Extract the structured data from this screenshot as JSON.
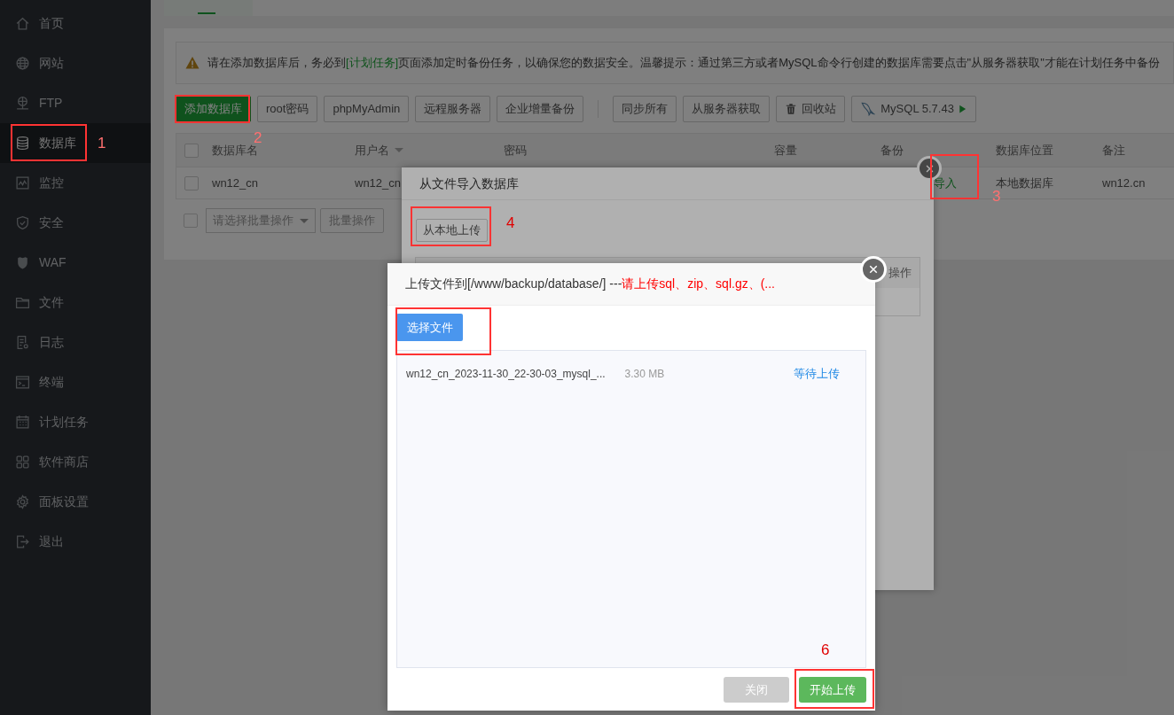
{
  "sidebar": {
    "items": [
      {
        "label": "首页",
        "selected": false
      },
      {
        "label": "网站",
        "selected": false
      },
      {
        "label": "FTP",
        "selected": false
      },
      {
        "label": "数据库",
        "selected": true
      },
      {
        "label": "监控",
        "selected": false
      },
      {
        "label": "安全",
        "selected": false
      },
      {
        "label": "WAF",
        "selected": false
      },
      {
        "label": "文件",
        "selected": false
      },
      {
        "label": "日志",
        "selected": false
      },
      {
        "label": "终端",
        "selected": false
      },
      {
        "label": "计划任务",
        "selected": false
      },
      {
        "label": "软件商店",
        "selected": false
      },
      {
        "label": "面板设置",
        "selected": false
      },
      {
        "label": "退出",
        "selected": false
      }
    ]
  },
  "alert": {
    "before": "请在添加数据库后，务必到",
    "link": "[计划任务]",
    "after": "页面添加定时备份任务，以确保您的数据安全。温馨提示：通过第三方或者MySQL命令行创建的数据库需要点击\"从服务器获取\"才能在计划任务中备份"
  },
  "toolbar": {
    "groups": [
      [
        {
          "label": "添加数据库",
          "kind": "primary"
        },
        {
          "label": "root密码",
          "kind": "default"
        },
        {
          "label": "phpMyAdmin",
          "kind": "default"
        },
        {
          "label": "远程服务器",
          "kind": "default"
        },
        {
          "label": "企业增量备份",
          "kind": "default"
        }
      ],
      [
        {
          "label": "同步所有",
          "kind": "default"
        },
        {
          "label": "从服务器获取",
          "kind": "default"
        },
        {
          "label": "回收站",
          "kind": "trash"
        },
        {
          "label": "MySQL 5.7.43",
          "kind": "mysql"
        }
      ]
    ]
  },
  "table": {
    "all_checked": false,
    "columns": [
      "数据库名",
      "用户名",
      "密码",
      "容量",
      "备份",
      "数据库位置",
      "备注"
    ],
    "rows": [
      {
        "checked": false,
        "name": "wn12_cn",
        "user": "wn12_cn",
        "action": "导入",
        "location": "本地数据库",
        "note": "wn12.cn"
      }
    ]
  },
  "batch": {
    "checked": false,
    "placeholder": "请选择批量操作",
    "button": "批量操作"
  },
  "import_dialog": {
    "title": "从文件导入数据库",
    "upload_button": "从本地上传",
    "column": "操作"
  },
  "upload_dialog": {
    "title": "上传文件到[/www/backup/database/] --- ",
    "hint": "请上传sql、zip、sql.gz、(...",
    "choose_button": "选择文件",
    "files": [
      {
        "name": "wn12_cn_2023-11-30_22-30-03_mysql_...",
        "size": "3.30 MB",
        "status": "等待上传"
      }
    ],
    "close_button": "关闭",
    "start_button": "开始上传"
  },
  "annotations": [
    {
      "number": "1"
    },
    {
      "number": "2"
    },
    {
      "number": "3"
    },
    {
      "number": "4"
    },
    {
      "number": "6"
    }
  ]
}
